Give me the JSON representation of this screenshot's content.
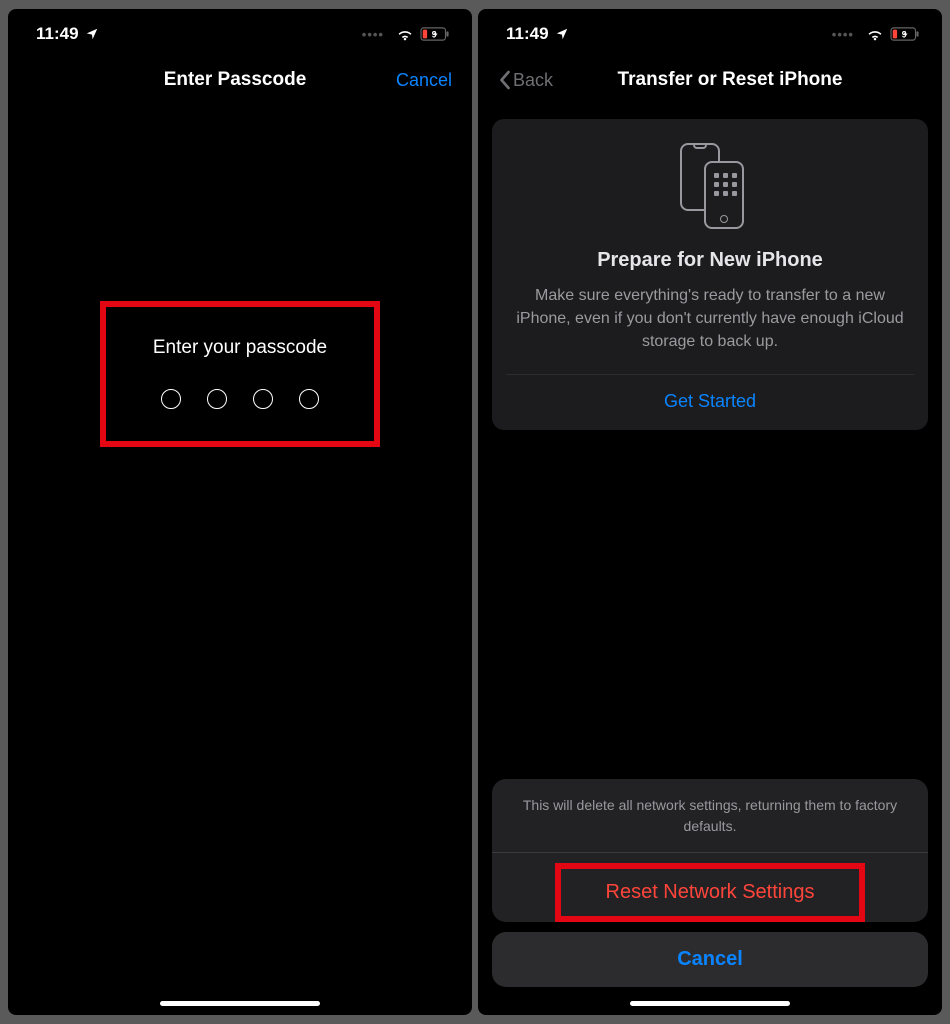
{
  "statusBar": {
    "time": "11:49",
    "batteryText": "9"
  },
  "screenA": {
    "title": "Enter Passcode",
    "cancel": "Cancel",
    "prompt": "Enter your passcode"
  },
  "screenB": {
    "back": "Back",
    "title": "Transfer or Reset iPhone",
    "card": {
      "title": "Prepare for New iPhone",
      "desc": "Make sure everything's ready to transfer to a new iPhone, even if you don't currently have enough iCloud storage to back up.",
      "button": "Get Started"
    },
    "sheet": {
      "message": "This will delete all network settings, returning them to factory defaults.",
      "action": "Reset Network Settings",
      "cancel": "Cancel"
    }
  }
}
